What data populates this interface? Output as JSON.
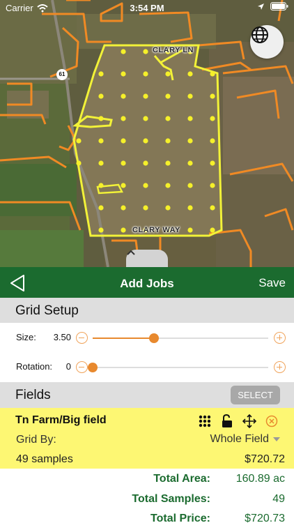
{
  "status_bar": {
    "carrier": "Carrier",
    "time": "3:54 PM"
  },
  "map": {
    "road_label_top": "CLARY LN",
    "road_label_bottom": "CLARY WAY",
    "route_shield": "61",
    "sample_point_color": "#f5f02a",
    "field_boundary_color": "#f2f238",
    "parcel_line_color": "#f08a24",
    "globe_icon": "globe-icon"
  },
  "navbar": {
    "title": "Add Jobs",
    "save_label": "Save",
    "color": "#1b6b2f"
  },
  "grid_setup": {
    "title": "Grid Setup",
    "size_label": "Size:",
    "size_value": "3.50",
    "size_fraction": 0.35,
    "rotation_label": "Rotation:",
    "rotation_value": "0",
    "rotation_fraction": 0.0
  },
  "fields": {
    "title": "Fields",
    "select_label": "SELECT",
    "items": [
      {
        "name": "Tn Farm/Big field",
        "grid_by_label": "Grid By:",
        "grid_by_value": "Whole Field",
        "samples": "49 samples",
        "price": "$720.72",
        "highlight_color": "#fdf773"
      }
    ]
  },
  "totals": {
    "area_label": "Total Area:",
    "area_value": "160.89 ac",
    "samples_label": "Total Samples:",
    "samples_value": "49",
    "price_label": "Total Price:",
    "price_value": "$720.73"
  }
}
